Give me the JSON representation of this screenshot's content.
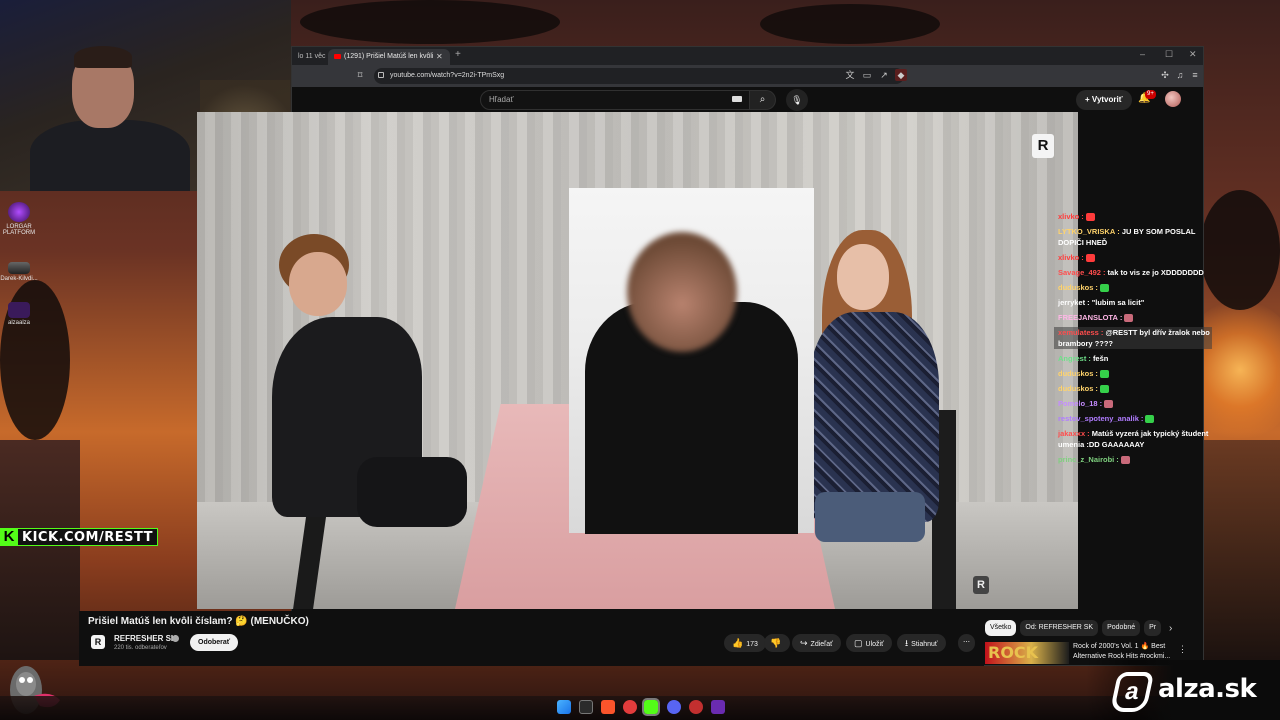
{
  "browser": {
    "tabs": [
      {
        "label": "lo 11 věc"
      },
      {
        "label": "(1291) Prišiel Matúš len kvôli"
      }
    ],
    "url": "youtube.com/watch?v=2n2i-TPmSxg"
  },
  "youtube": {
    "search_placeholder": "Hľadať",
    "create_label": "Vytvoriť",
    "notifications_badge": "9+",
    "video_title": "Prišiel Matúš len kvôli číslam? 🤔 (MENUČKO)",
    "channel_name": "REFRESHER SK",
    "channel_subs": "220 tis. odberateľov",
    "subscribe_label": "Odoberať",
    "actions": {
      "likes": "173",
      "share": "Zdieľať",
      "save": "Uložiť",
      "download": "Stiahnuť"
    },
    "chips": [
      "Všetko",
      "Od: REFRESHER SK",
      "Podobné",
      "Pr"
    ],
    "recommendation": {
      "thumb_text": "ROCK",
      "title": "Rock of 2000's Vol. 1 🔥 Best Alternative Rock Hits #rockmi..."
    }
  },
  "stream": {
    "kick_banner": "KICK.COM/RESTT",
    "desktop_icons": [
      "LORGAR PLATFORM",
      "Darek-Kilvdi...",
      "alzaalza"
    ],
    "sponsor": "alza.sk"
  },
  "chat": [
    {
      "user": "xlivko",
      "user_color": "#ff3b3b",
      "text": "",
      "emote": "#ff3b3b"
    },
    {
      "user": "LYTKO_VRISKA",
      "user_color": "#ffd36b",
      "text": "JU BY SOM POSLAL DOPIČI HNEĎ",
      "emote": ""
    },
    {
      "user": "xlivko",
      "user_color": "#ff3b3b",
      "text": "",
      "emote": "#ff3b3b"
    },
    {
      "user": "Savage_492",
      "user_color": "#ff4d4d",
      "text": "tak to vis ze jo XDDDDDDD",
      "emote": ""
    },
    {
      "user": "duduskos",
      "user_color": "#ffd36b",
      "text": "",
      "emote": "#35d04a"
    },
    {
      "user": "jerryket",
      "user_color": "#ffffff",
      "text": "\"lubim sa licit\"",
      "emote": ""
    },
    {
      "user": "FREEJANSLOTA",
      "user_color": "#ffb6e6",
      "text": "",
      "emote": "#c96a7a"
    },
    {
      "user": "xemulatess",
      "user_color": "#ff4d4d",
      "text": "@RESTT byl dřív žralok nebo brambory ????",
      "emote": "",
      "highlight": true
    },
    {
      "user": "Angrest",
      "user_color": "#6fe08a",
      "text": "fešn",
      "emote": ""
    },
    {
      "user": "duduskos",
      "user_color": "#ffd36b",
      "text": "",
      "emote": "#35d04a"
    },
    {
      "user": "duduskos",
      "user_color": "#ffd36b",
      "text": "",
      "emote": "#35d04a"
    },
    {
      "user": "Pomelo_18",
      "user_color": "#c58cff",
      "text": "",
      "emote": "#c96a7a"
    },
    {
      "user": "restov_spoteny_analik",
      "user_color": "#b07cff",
      "text": "",
      "emote": "#35d04a"
    },
    {
      "user": "jakaxxx",
      "user_color": "#ff4d4d",
      "text": "Matúš vyzerá jak typický študent umenia :DD GAAAAAAY",
      "emote": ""
    },
    {
      "user": "princ_z_Nairobi",
      "user_color": "#7fd17f",
      "text": "",
      "emote": "#c96a7a"
    }
  ]
}
